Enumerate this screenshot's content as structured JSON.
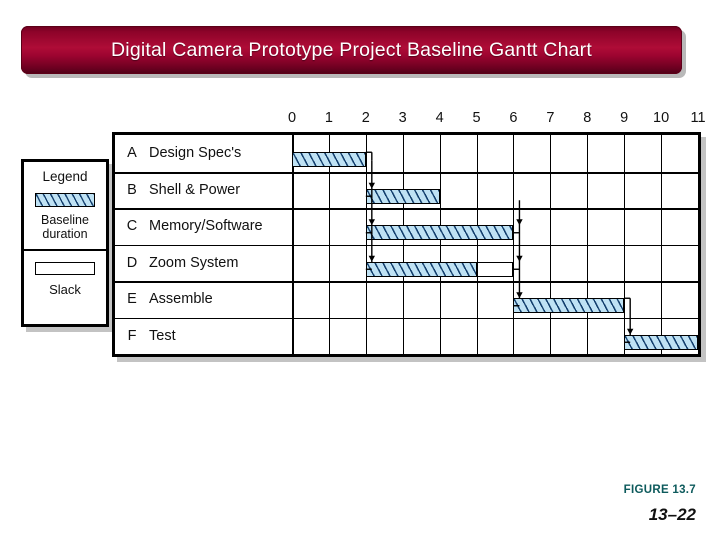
{
  "title": {
    "text": "Digital Camera Prototype Project Baseline Gantt Chart",
    "bar_color": "#8d0329",
    "text_color": "#ffffff"
  },
  "legend": {
    "heading": "Legend",
    "baseline_label": "Baseline\nduration",
    "baseline_label_line1": "Baseline",
    "baseline_label_line2": "duration",
    "slack_label": "Slack",
    "baseline_fill": "#bfe2f4",
    "baseline_hatch": "#14406e",
    "slack_fill": "#ffffff"
  },
  "footer": {
    "figure_label": "FIGURE 13.7",
    "figure_color": "#0d5a5c",
    "slide_number": "13–22"
  },
  "chart_data": {
    "type": "bar",
    "subtype": "gantt",
    "title": "Digital Camera Prototype Project Baseline Gantt Chart",
    "xlabel": "",
    "ylabel": "",
    "xlim": [
      0,
      11
    ],
    "x_ticks": [
      0,
      1,
      2,
      3,
      4,
      5,
      6,
      7,
      8,
      9,
      10,
      11
    ],
    "x_tick_labels": [
      "0",
      "1",
      "2",
      "3",
      "4",
      "5",
      "6",
      "7",
      "8",
      "9",
      "10",
      "11"
    ],
    "grid": true,
    "legend_position": "left-outside",
    "categories": [
      "A",
      "B",
      "C",
      "D",
      "E",
      "F"
    ],
    "tasks": [
      {
        "key": "A",
        "name": "Design Spec's",
        "start": 0,
        "end": 2,
        "duration": 2,
        "slack_start": 2,
        "slack_end": 2,
        "slack": 0
      },
      {
        "key": "B",
        "name": "Shell & Power",
        "start": 2,
        "end": 4,
        "duration": 2,
        "slack_start": 4,
        "slack_end": 4,
        "slack": 0
      },
      {
        "key": "C",
        "name": "Memory/Software",
        "start": 2,
        "end": 6,
        "duration": 4,
        "slack_start": 6,
        "slack_end": 6,
        "slack": 0
      },
      {
        "key": "D",
        "name": "Zoom System",
        "start": 2,
        "end": 5,
        "duration": 3,
        "slack_start": 5,
        "slack_end": 6,
        "slack": 1
      },
      {
        "key": "E",
        "name": "Assemble",
        "start": 6,
        "end": 9,
        "duration": 3,
        "slack_start": 9,
        "slack_end": 9,
        "slack": 0
      },
      {
        "key": "F",
        "name": "Test",
        "start": 9,
        "end": 11,
        "duration": 2,
        "slack_start": 11,
        "slack_end": 11,
        "slack": 0
      }
    ],
    "dependencies": [
      {
        "from": "A",
        "to": "B"
      },
      {
        "from": "A",
        "to": "C"
      },
      {
        "from": "A",
        "to": "D"
      },
      {
        "from": "C",
        "to": "E"
      },
      {
        "from": "D",
        "to": "E"
      },
      {
        "from": "E",
        "to": "F"
      }
    ]
  }
}
